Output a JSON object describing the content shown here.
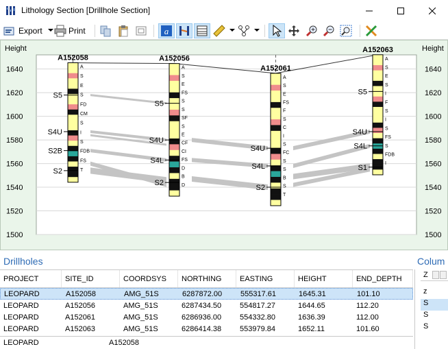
{
  "window": {
    "title": "Lithology Section [Drillhole Section]",
    "icon": "section-app-icon",
    "controls": [
      "minimize",
      "maximize",
      "close"
    ]
  },
  "toolbar": {
    "export_label": "Export",
    "print_label": "Print",
    "icons": [
      "export-icon",
      "dropdown-arrow",
      "print-icon",
      "copy-icon",
      "paste-icon",
      "frame-icon",
      "labels-icon",
      "section-icon",
      "table-icon",
      "ruler-icon",
      "dropdown-arrow",
      "nodes-icon",
      "dropdown-arrow",
      "select-arrow-icon",
      "pan-icon",
      "zoom-in-icon",
      "zoom-out-icon",
      "zoom-extents-icon",
      "clear-icon"
    ]
  },
  "chart": {
    "y_axis_label_left": "Height",
    "y_axis_label_right": "Height",
    "ticks": [
      "1640",
      "1620",
      "1600",
      "1580",
      "1560",
      "1540",
      "1520",
      "1500"
    ],
    "tick_values": [
      1640,
      1620,
      1600,
      1580,
      1560,
      1540,
      1520,
      1500
    ],
    "ylim": [
      1500,
      1652
    ],
    "holes": [
      {
        "name": "A152058",
        "top_elev": 1645.31,
        "bottom_elev": 1544.21,
        "unit_labels": [
          {
            "text": "S5",
            "elev": 1618
          },
          {
            "text": "S4U",
            "elev": 1587
          },
          {
            "text": "S2B",
            "elev": 1571
          },
          {
            "text": "S2",
            "elev": 1554
          }
        ],
        "codes": [
          "A",
          "S",
          "E",
          "S",
          "FD",
          "CM",
          "S",
          "I",
          "S",
          "FDB",
          "FS",
          "T"
        ]
      },
      {
        "name": "A152056",
        "top_elev": 1644.65,
        "bottom_elev": 1532.45,
        "unit_labels": [
          {
            "text": "S5",
            "elev": 1611
          },
          {
            "text": "S4U",
            "elev": 1580
          },
          {
            "text": "S4L",
            "elev": 1563
          },
          {
            "text": "S2",
            "elev": 1544
          }
        ],
        "codes": [
          "A",
          "S",
          "E",
          "FS",
          "S",
          "S",
          "SF",
          "S",
          "E",
          "CF",
          "CI",
          "FS",
          "D",
          "B",
          "D"
        ]
      },
      {
        "name": "A152061",
        "top_elev": 1636.39,
        "bottom_elev": 1524.39,
        "unit_labels": [
          {
            "text": "S4U",
            "elev": 1573
          },
          {
            "text": "S4L",
            "elev": 1558
          },
          {
            "text": "S2",
            "elev": 1540
          }
        ],
        "codes": [
          "A",
          "S",
          "E",
          "FS",
          "F",
          "S",
          "C",
          "I",
          "S",
          "FC",
          "S",
          "S",
          "B",
          "S",
          "T"
        ]
      },
      {
        "name": "A152063",
        "top_elev": 1652.11,
        "bottom_elev": 1550.51,
        "unit_labels": [
          {
            "text": "S5",
            "elev": 1621
          },
          {
            "text": "S4U",
            "elev": 1587
          },
          {
            "text": "S4L",
            "elev": 1575
          },
          {
            "text": "S1",
            "elev": 1557
          }
        ],
        "codes": [
          "A",
          "S",
          "E",
          "S",
          "I",
          "F",
          "S",
          "I",
          "S",
          "FS",
          "S",
          "FDB",
          "I"
        ]
      }
    ]
  },
  "drillholes_panel": {
    "title": "Drillholes",
    "columns": [
      "PROJECT",
      "SITE_ID",
      "COORDSYS",
      "NORTHING",
      "EASTING",
      "HEIGHT",
      "END_DEPTH"
    ],
    "rows": [
      [
        "LEOPARD",
        "A152058",
        "AMG_51S",
        "6287872.00",
        "555317.61",
        "1645.31",
        "101.10"
      ],
      [
        "LEOPARD",
        "A152056",
        "AMG_51S",
        "6287434.50",
        "554817.27",
        "1644.65",
        "112.20"
      ],
      [
        "LEOPARD",
        "A152061",
        "AMG_51S",
        "6286936.00",
        "554332.80",
        "1636.39",
        "112.00"
      ],
      [
        "LEOPARD",
        "A152063",
        "AMG_51S",
        "6286414.38",
        "553979.84",
        "1652.11",
        "101.60"
      ]
    ],
    "selected_row": 0,
    "status": [
      "LEOPARD",
      "A152058"
    ]
  },
  "column_panel": {
    "title": "Colum",
    "header": "Z",
    "values": [
      "z",
      "S",
      "S",
      "S"
    ]
  },
  "colors": {
    "accent": "#2e6bb5",
    "chart_bg": "#eaf5ea",
    "correlation": "#c4c4c4",
    "yellow": "#ffffa0",
    "salmon": "#f08c8c",
    "teal": "#2aa79b",
    "green": "#20c040",
    "selection": "#cde4f8"
  }
}
